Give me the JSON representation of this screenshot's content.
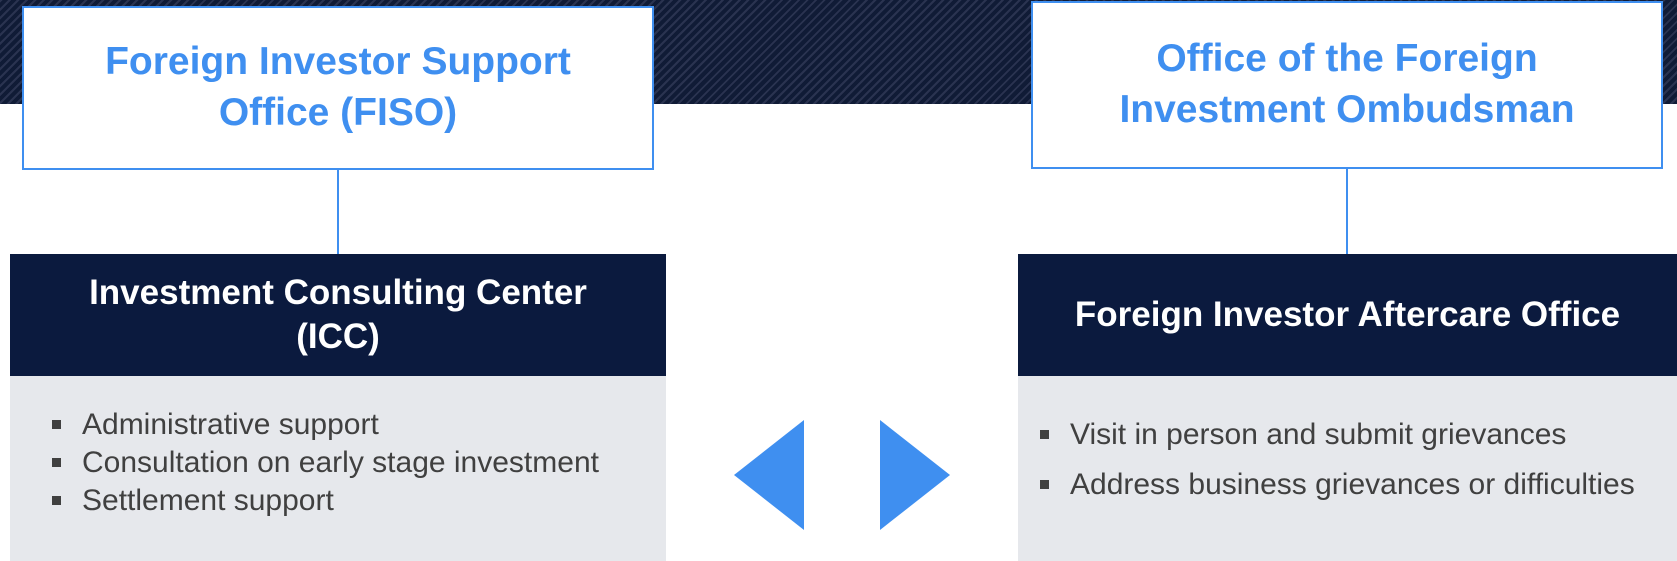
{
  "left": {
    "title_lines": [
      "Foreign Investor Support",
      "Office (FISO)"
    ],
    "department_lines": [
      "Investment Consulting Center",
      "(ICC)"
    ],
    "items": [
      "Administrative support",
      "Consultation on early stage investment",
      "Settlement support"
    ]
  },
  "right": {
    "title_lines": [
      "Office of the Foreign",
      "Investment Ombudsman"
    ],
    "department_lines": [
      "Foreign Investor Aftercare Office"
    ],
    "items": [
      "Visit in person and submit grievances",
      "Address business grievances or difficulties"
    ]
  },
  "colors": {
    "accent_blue": "#3f8ff0",
    "dark_navy": "#0b1a3e",
    "list_bg": "#e6e8ec",
    "text_gray": "#404040"
  },
  "icons": {
    "left_arrow": "triangle-left-icon",
    "right_arrow": "triangle-right-icon"
  }
}
